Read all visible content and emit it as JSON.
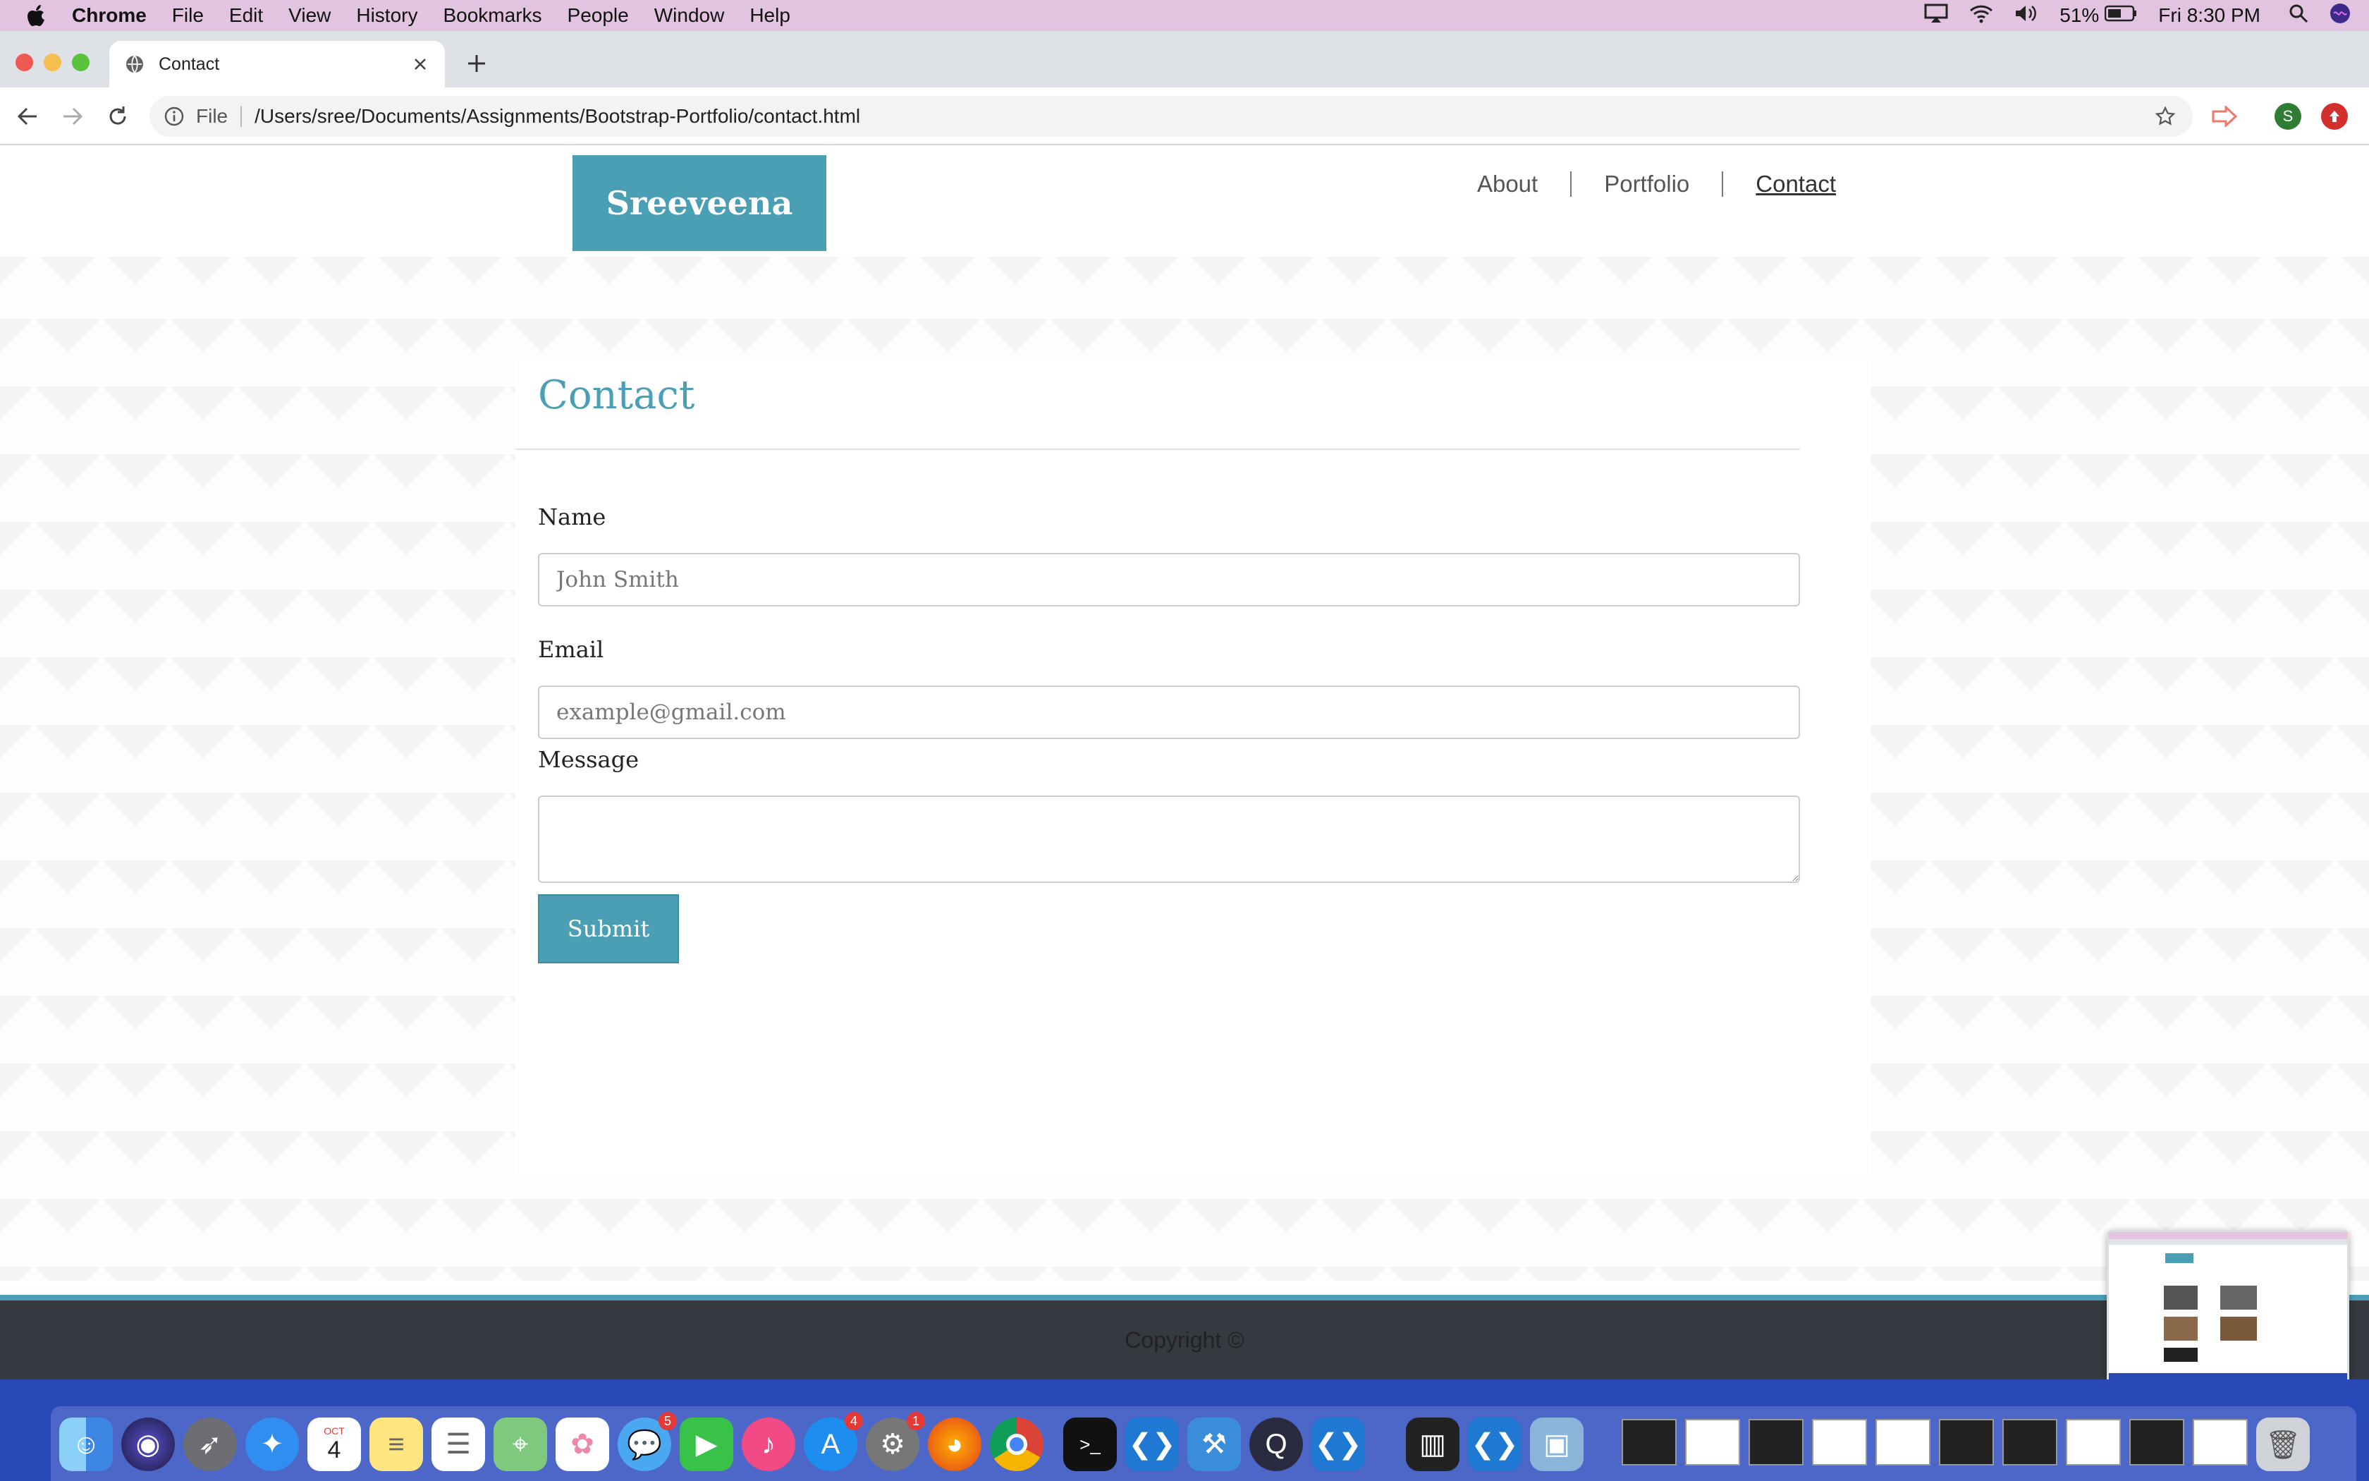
{
  "menubar": {
    "app": "Chrome",
    "items": [
      "File",
      "Edit",
      "View",
      "History",
      "Bookmarks",
      "People",
      "Window",
      "Help"
    ],
    "battery": "51%",
    "clock": "Fri 8:30 PM"
  },
  "browser": {
    "tab_title": "Contact",
    "scheme": "File",
    "url": "/Users/sree/Documents/Assignments/Bootstrap-Portfolio/contact.html",
    "profile_initial": "S"
  },
  "site": {
    "brand": "Sreeveena",
    "nav": [
      "About",
      "Portfolio",
      "Contact"
    ],
    "active_nav": "Contact",
    "accent": "#4a9fb5"
  },
  "form": {
    "heading": "Contact",
    "name_label": "Name",
    "name_placeholder": "John Smith",
    "email_label": "Email",
    "email_placeholder": "example@gmail.com",
    "message_label": "Message",
    "submit_label": "Submit"
  },
  "footer": {
    "copyright": "Copyright ©"
  },
  "dock": {
    "calendar_month": "OCT",
    "calendar_day": "4",
    "messages_badge": "5",
    "appstore_badge": "4",
    "prefs_badge": "1"
  }
}
